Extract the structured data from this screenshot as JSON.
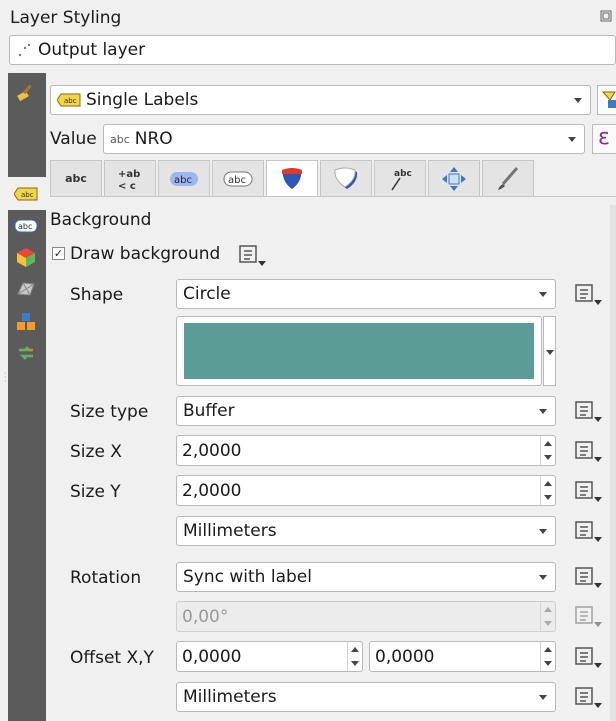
{
  "panel": {
    "title": "Layer Styling",
    "float_icon": "float-icon"
  },
  "layer_select": {
    "value": "Output layer",
    "icon": "point-layer-icon"
  },
  "sidebar": {
    "items": [
      {
        "name": "symbology-brush-icon"
      },
      {
        "name": "labels-icon",
        "active": true
      },
      {
        "name": "masks-icon"
      },
      {
        "name": "3d-view-icon"
      },
      {
        "name": "mesh-icon"
      },
      {
        "name": "diagrams-icon"
      },
      {
        "name": "history-icon"
      }
    ]
  },
  "label_mode": {
    "value": "Single Labels",
    "icon_text": "abc"
  },
  "value_row": {
    "label": "Value",
    "abc": "abc",
    "value": "NRO",
    "expr_glyph": "ε"
  },
  "tabs": [
    {
      "name": "tab-text",
      "text": "abc"
    },
    {
      "name": "tab-formatting",
      "text": "+ab\n< c"
    },
    {
      "name": "tab-buffer",
      "text": "abc"
    },
    {
      "name": "tab-mask",
      "text": "abc"
    },
    {
      "name": "tab-background",
      "text": "",
      "active": true
    },
    {
      "name": "tab-shadow",
      "text": ""
    },
    {
      "name": "tab-callouts",
      "text": "abc"
    },
    {
      "name": "tab-placement",
      "text": ""
    },
    {
      "name": "tab-rendering",
      "text": ""
    }
  ],
  "section": {
    "title": "Background"
  },
  "draw_background": {
    "label": "Draw background",
    "checked": "✓"
  },
  "form": {
    "shape": {
      "label": "Shape",
      "value": "Circle"
    },
    "fill_color": "#5c9c96",
    "size_type": {
      "label": "Size type",
      "value": "Buffer"
    },
    "size_x": {
      "label": "Size X",
      "value": "2,0000"
    },
    "size_y": {
      "label": "Size Y",
      "value": "2,0000"
    },
    "size_units": {
      "value": "Millimeters"
    },
    "rotation": {
      "label": "Rotation",
      "value": "Sync with label"
    },
    "rotation_angle": {
      "value": "0,00°"
    },
    "offset": {
      "label": "Offset X,Y",
      "x": "0,0000",
      "y": "0,0000"
    },
    "offset_units": {
      "value": "Millimeters"
    }
  }
}
